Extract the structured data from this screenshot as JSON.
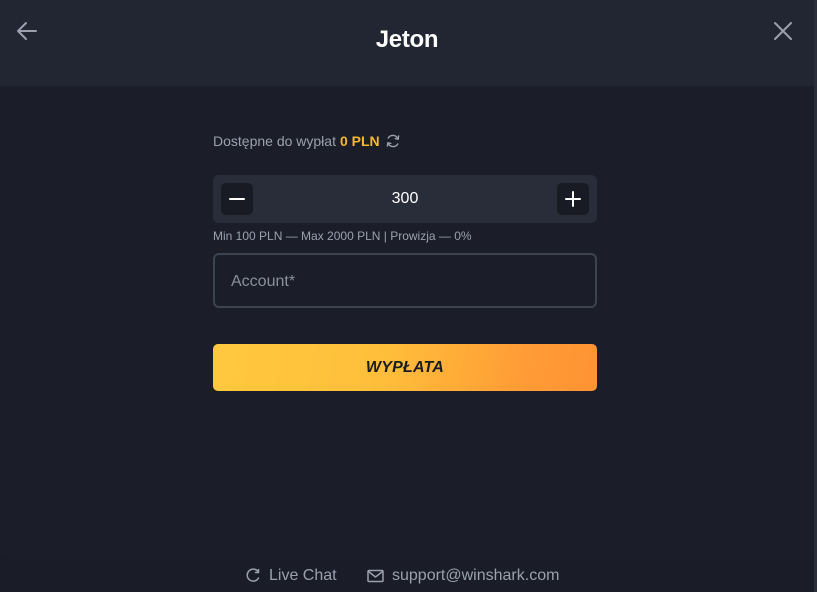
{
  "header": {
    "title": "Jeton",
    "back_icon": "arrow-left-icon",
    "close_icon": "close-icon"
  },
  "withdraw": {
    "available_label": "Dostępne do wypłat",
    "available_amount": "0 PLN",
    "refresh_icon": "refresh-icon",
    "amount_value": "300",
    "limits_text": "Min 100 PLN — Max 2000 PLN | Prowizja — 0%",
    "account_placeholder": "Account*",
    "account_value": "",
    "submit_label": "WYPŁATA"
  },
  "footer": {
    "live_chat_label": "Live Chat",
    "live_chat_icon": "chat-icon",
    "support_email": "support@winshark.com",
    "support_icon": "mail-icon"
  },
  "colors": {
    "accent": "#f5b82e",
    "button_gradient_start": "#ffc93e",
    "button_gradient_end": "#ff9333",
    "background": "#1b1e28",
    "header_background": "#222632"
  }
}
